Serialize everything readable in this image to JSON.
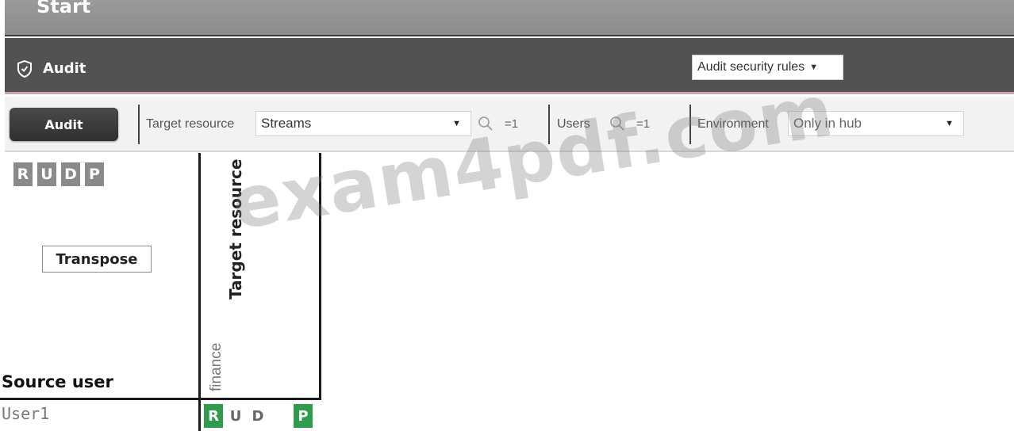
{
  "start_bar": {
    "title": "Start"
  },
  "audit_header": {
    "title": "Audit",
    "icon": "shield-icon",
    "rules_select": "Audit security rules"
  },
  "toolbar": {
    "audit_button": "Audit",
    "target_resource": {
      "label": "Target resource",
      "value": "Streams",
      "count": "=1"
    },
    "users": {
      "label": "Users",
      "count": "=1"
    },
    "environment": {
      "label": "Environment",
      "value": "Only in hub"
    }
  },
  "grid": {
    "permission_legend": [
      "R",
      "U",
      "D",
      "P"
    ],
    "transpose_button": "Transpose",
    "target_header": "Target resource",
    "source_header": "Source user",
    "columns": [
      "finance"
    ],
    "rows": [
      {
        "user": "User1",
        "permissions": [
          {
            "letter": "R",
            "granted": true
          },
          {
            "letter": "U",
            "granted": false
          },
          {
            "letter": "D",
            "granted": false
          },
          {
            "letter": "P",
            "granted": true
          }
        ]
      }
    ]
  },
  "watermark": "exam4pdf.com",
  "colors": {
    "granted": "#2e9c4c",
    "header_dark": "#525252",
    "legend_gray": "#8a8a8a"
  }
}
